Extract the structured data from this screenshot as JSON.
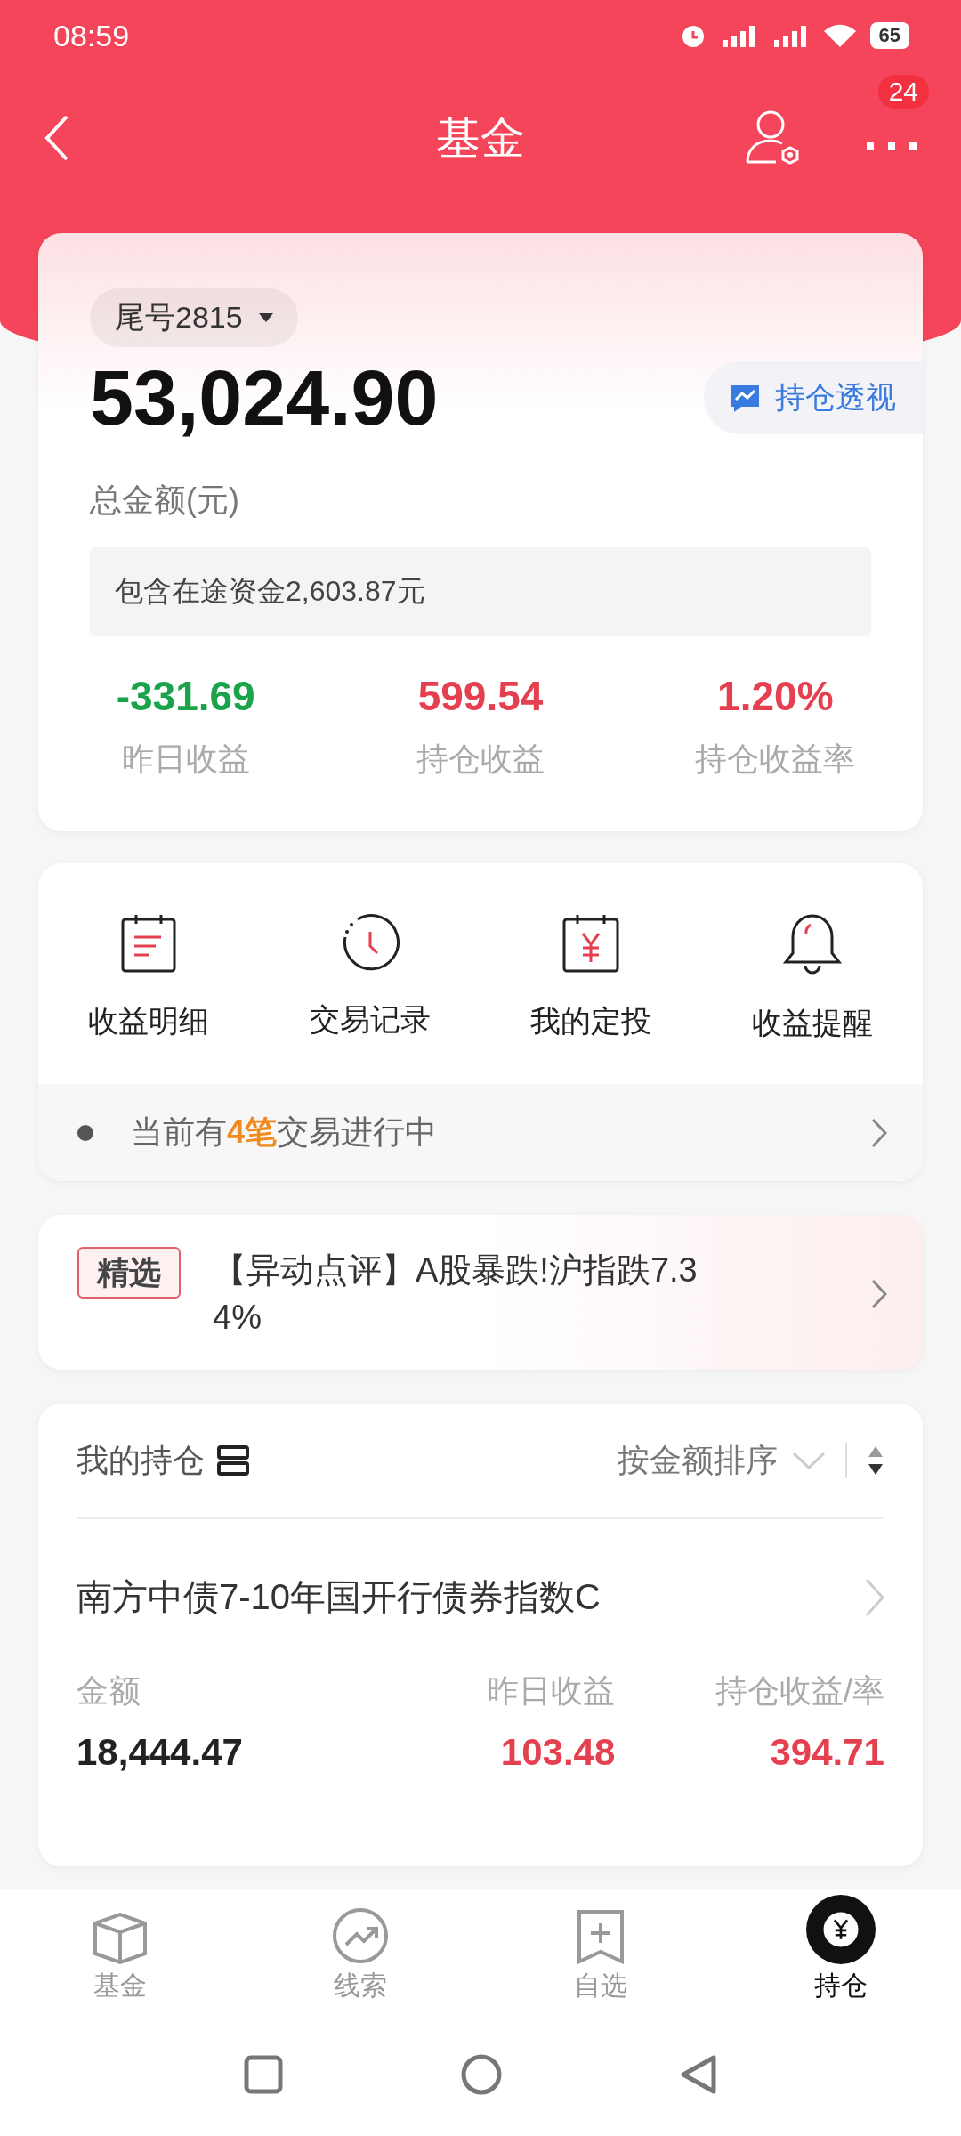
{
  "status_bar": {
    "time": "08:59",
    "battery": "65"
  },
  "header": {
    "title": "基金",
    "badge": "24"
  },
  "account": {
    "selector": "尾号2815",
    "total": "53,024.90",
    "total_label": "总金额(元)",
    "insight_button": "持仓透视",
    "in_transit": "包含在途资金2,603.87元",
    "stats": [
      {
        "value": "-331.69",
        "label": "昨日收益",
        "kind": "loss"
      },
      {
        "value": "599.54",
        "label": "持仓收益",
        "kind": "gain"
      },
      {
        "value": "1.20%",
        "label": "持仓收益率",
        "kind": "gain"
      }
    ]
  },
  "shortcuts": [
    {
      "label": "收益明细",
      "kind": "list"
    },
    {
      "label": "交易记录",
      "kind": "clock"
    },
    {
      "label": "我的定投",
      "kind": "calendar"
    },
    {
      "label": "收益提醒",
      "kind": "bell"
    }
  ],
  "pending": {
    "text": "当前有**4笔**交易进行中"
  },
  "news": {
    "tag": "精选",
    "text": "【异动点评】A股暴跌!沪指跌7.34%"
  },
  "holdings": {
    "title": "我的持仓",
    "sort": "按金额排序",
    "columns": [
      "金额",
      "昨日收益",
      "持仓收益/率"
    ],
    "items": [
      {
        "name": "南方中债7-10年国开行债券指数C",
        "amount": "18,444.47",
        "yesterday": "103.48",
        "profit": "394.71"
      }
    ]
  },
  "bottom_nav": [
    {
      "label": "基金",
      "kind": "box",
      "selected": false
    },
    {
      "label": "线索",
      "kind": "trend",
      "selected": false
    },
    {
      "label": "自选",
      "kind": "bookmark",
      "selected": false
    },
    {
      "label": "持仓",
      "kind": "yuan",
      "selected": true
    }
  ]
}
